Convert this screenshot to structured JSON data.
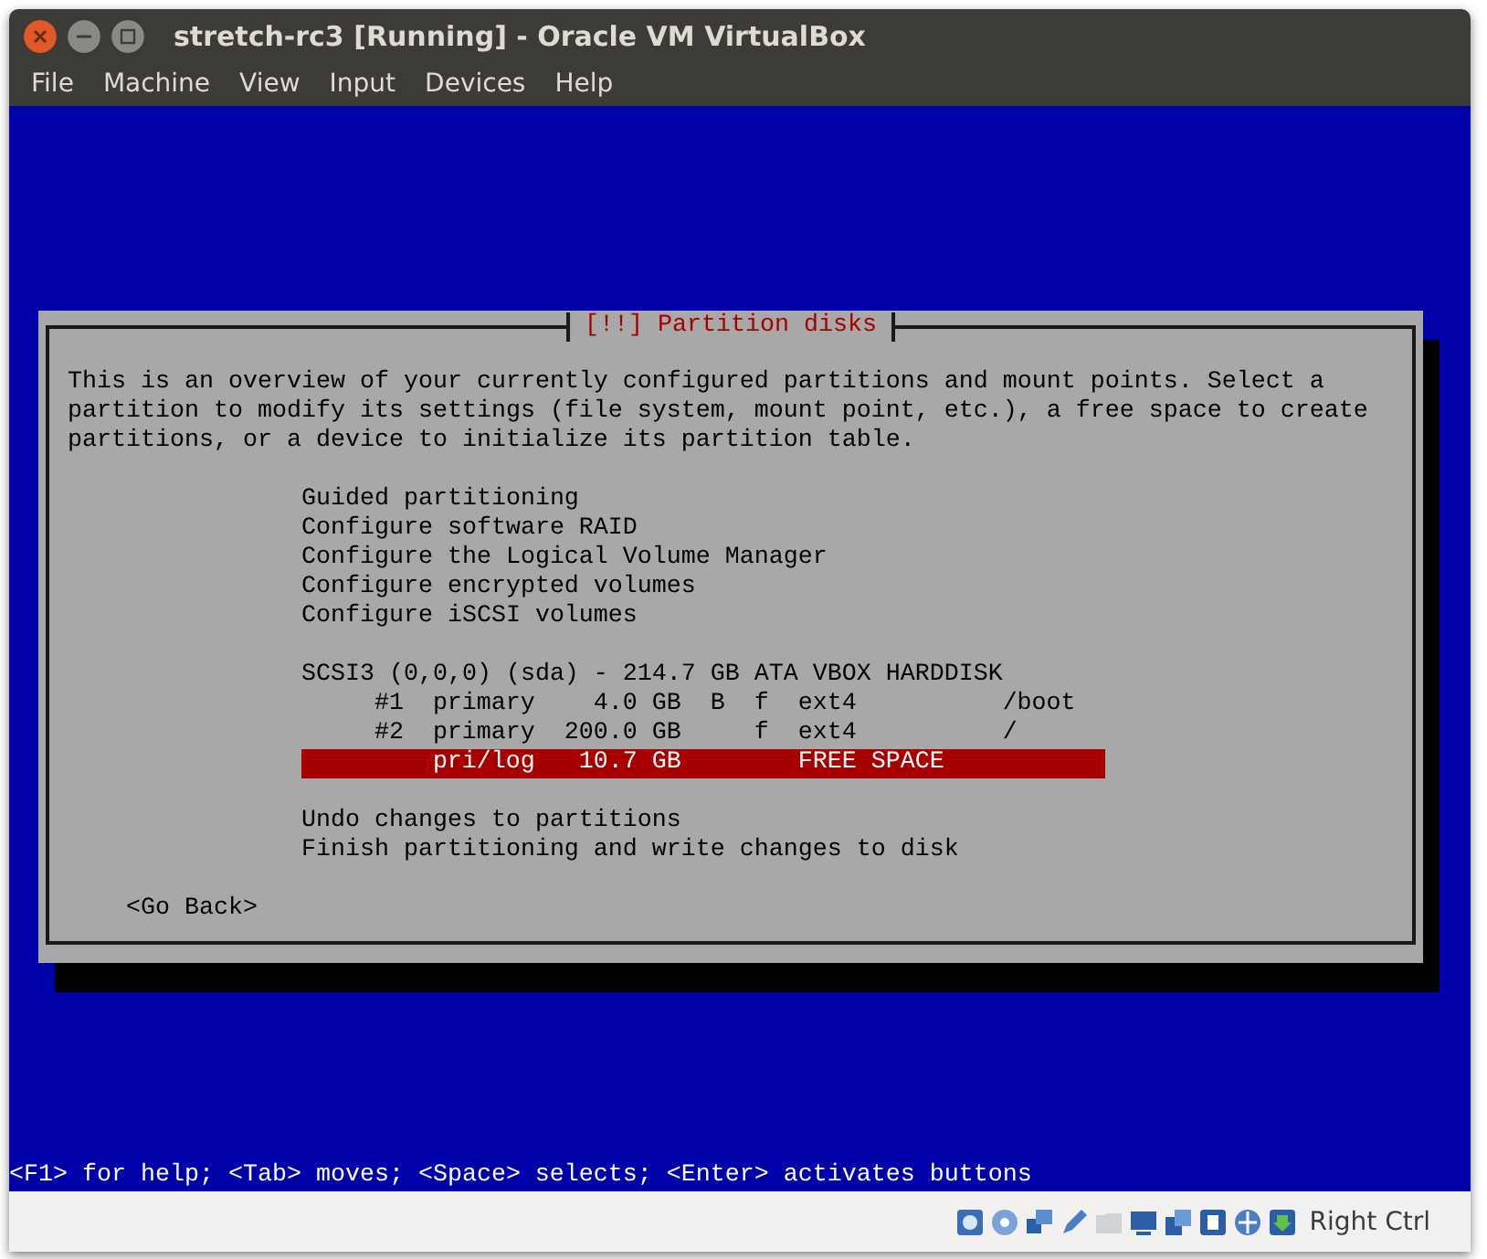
{
  "window": {
    "title": "stretch-rc3 [Running] - Oracle VM VirtualBox"
  },
  "menu_bar": [
    "File",
    "Machine",
    "View",
    "Input",
    "Devices",
    "Help"
  ],
  "dialog": {
    "title": "[!!] Partition disks",
    "description": "This is an overview of your currently configured partitions and mount points. Select a partition to modify its settings (file system, mount point, etc.), a free space to create partitions, or a device to initialize its partition table.",
    "actions": [
      {
        "label": "Guided partitioning",
        "selected": false
      },
      {
        "label": "Configure software RAID",
        "selected": false
      },
      {
        "label": "Configure the Logical Volume Manager",
        "selected": false
      },
      {
        "label": "Configure encrypted volumes",
        "selected": false
      },
      {
        "label": "Configure iSCSI volumes",
        "selected": false
      }
    ],
    "disk": {
      "label": "SCSI3 (0,0,0) (sda) - 214.7 GB ATA VBOX HARDDISK",
      "selected": false
    },
    "partitions": [
      {
        "number": "#1",
        "type": "primary",
        "size": "4.0 GB",
        "bootable": "B",
        "format": "f",
        "filesystem": "ext4",
        "mount": "/boot",
        "selected": false
      },
      {
        "number": "#2",
        "type": "primary",
        "size": "200.0 GB",
        "format": "f",
        "filesystem": "ext4",
        "mount": "/",
        "selected": false
      },
      {
        "type": "pri/log",
        "size": "10.7 GB",
        "filesystem": "FREE SPACE",
        "selected": true
      }
    ],
    "final_actions": [
      {
        "label": "Undo changes to partitions",
        "selected": false
      },
      {
        "label": "Finish partitioning and write changes to disk",
        "selected": false
      }
    ],
    "back_button": "<Go Back>"
  },
  "help_line": "<F1> for help; <Tab> moves; <Space> selects; <Enter> activates buttons",
  "status_bar": {
    "host_key": "Right Ctrl"
  }
}
